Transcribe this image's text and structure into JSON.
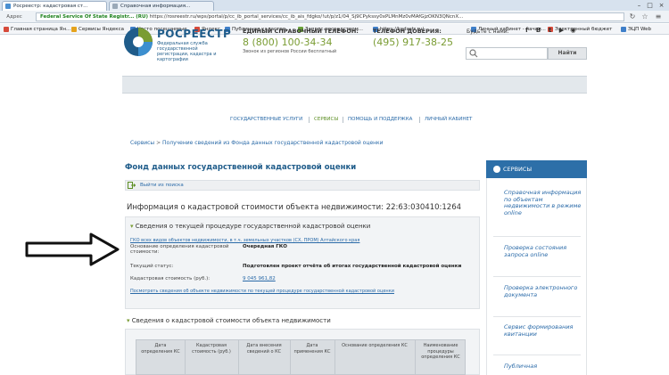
{
  "browser": {
    "tabs": [
      {
        "title": "Росреестр: кадастровая ст..."
      },
      {
        "title": "Справочная информация..."
      }
    ],
    "address_label": "Адрес",
    "url_site": "Federal Service Of State Registr... (RU)",
    "url": "https://rosreestr.ru/wps/portal/p/cc_ib_portal_services/cc_ib_ais_fdgko/!ut/p/z1/04_Sj9CPykssy0xPLMnMz0vMAfGjzOKN3QNcnX...",
    "bookmarks": [
      {
        "label": "Главная страница Ян...",
        "color": "#d64a3a"
      },
      {
        "label": "Сервисы Яндекса",
        "color": "#e5a31d"
      },
      {
        "label": "Часто посещаемые",
        "color": "#3f7fc9"
      },
      {
        "label": "Яндекс",
        "color": "#d64a3a"
      },
      {
        "label": "Публичная кадастро...",
        "color": "#3f7fc9"
      },
      {
        "label": "Запрос посредством...",
        "color": "#6ba33a"
      },
      {
        "label": "https://kadastr.ru/",
        "color": "#3f7fc9"
      },
      {
        "label": "Личный кабинет - начал...",
        "color": "#3f7fc9"
      },
      {
        "label": "Электронный бюджет",
        "color": "#d64a3a"
      },
      {
        "label": "ЭЦП Web",
        "color": "#3f7fc9"
      }
    ]
  },
  "header": {
    "logo_title": "РОСРЕЕСТР",
    "logo_sub": "Федеральная служба государственной регистрации, кадастра и картографии",
    "hotline_label": "ЕДИНЫЙ СПРАВОЧНЫЙ ТЕЛЕФОН:",
    "hotline_number": "8 (800) 100-34-34",
    "hotline_note": "Звонок из регионов России бесплатный",
    "trust_label": "ТЕЛЕФОН ДОВЕРИЯ:",
    "trust_number": "(495) 917-38-25",
    "social_label": "Будьте с нами:",
    "social": [
      "f",
      "В",
      "t",
      "▶",
      "◉"
    ],
    "search_placeholder": "",
    "search_button": "Найти"
  },
  "nav": {
    "items": [
      {
        "label": "ГОСУДАРСТВЕННЫЕ УСЛУГИ"
      },
      {
        "label": "СЕРВИСЫ"
      },
      {
        "label": "ПОМОЩЬ И ПОДДЕРЖКА"
      },
      {
        "label": "ЛИЧНЫЙ КАБИНЕТ"
      }
    ],
    "active_index": 1
  },
  "breadcrumb": {
    "root": "Сервисы",
    "separator": ">",
    "current": "Получение сведений из Фонда данных государственной кадастровой оценки"
  },
  "main": {
    "title": "Фонд данных государственной кадастровой оценки",
    "exit_link": "Выйти из поиска",
    "info_title": "Информация о кадастровой стоимости объекта недвижимости: 22:63:030410:1264",
    "section1_title": "Сведения о текущей процедуре государственной кадастровой оценки",
    "gko_link": "ГКО всех видов объектов недвижимости, в т.ч. земельных участков (СХ, ПРОМ) Алтайского края",
    "fields": [
      {
        "label": "Основание определения кадастровой стоимости:",
        "value": "Очередная ГКО"
      },
      {
        "label": "Текущий статус:",
        "value": "Подготовлен проект отчёта об итогах государственной кадастровой оценки"
      },
      {
        "label": "Кадастровая стоимость (руб.):",
        "value": ""
      }
    ],
    "cost_value": "9 045 961,82",
    "history_link": "Посмотреть сведения об объекте недвижимости по текущей процедуре государственной кадастровой оценки",
    "section2_title": "Сведения о кадастровой стоимости объекта недвижимости",
    "table_headers": [
      "Дата определения КС",
      "Кадастровая стоимость (руб.)",
      "Дата внесения сведений о КС",
      "Дата применения КС",
      "Основание определения КС",
      "Наименование процедуры определения КС"
    ]
  },
  "sidebar": {
    "header": "СЕРВИСЫ",
    "items": [
      {
        "label": "Справочная информация по объектам недвижимости в режиме online"
      },
      {
        "label": "Проверка состояния запроса online"
      },
      {
        "label": "Проверка электронного документа"
      },
      {
        "label": "Сервис формирования квитанции"
      },
      {
        "label": "Публичная"
      }
    ]
  },
  "colors": {
    "brand_blue": "#1f5c8a",
    "accent_green": "#7a9c33",
    "link_blue": "#2a6aa8",
    "sidebar_head": "#2d6fa8"
  }
}
